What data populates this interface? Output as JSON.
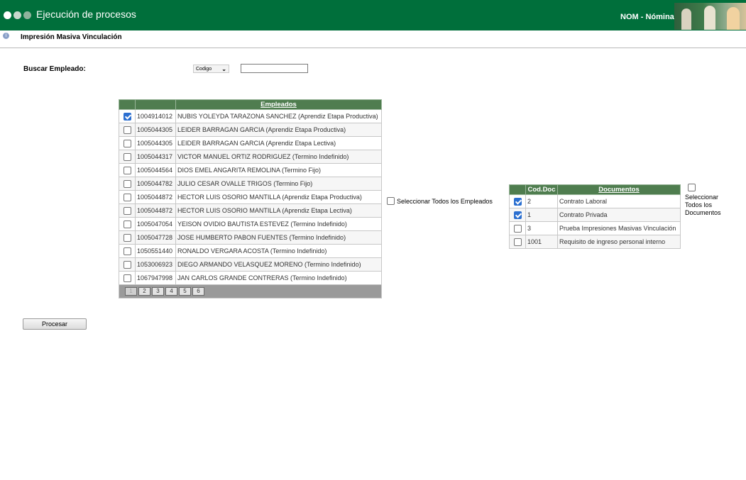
{
  "header": {
    "app_title": "Ejecución de procesos",
    "module": "NOM - Nómina",
    "color": "#006f3b"
  },
  "subheader": {
    "icon": "info-icon",
    "title": "Impresión Masiva  Vinculación"
  },
  "search": {
    "label": "Buscar Empleado:",
    "select_value": "Codigo",
    "input_value": ""
  },
  "employees": {
    "header": "Empleados",
    "rows": [
      {
        "checked": true,
        "code": "1004914012",
        "name": "NUBIS YOLEYDA TARAZONA SANCHEZ (Aprendiz Etapa Productiva)"
      },
      {
        "checked": false,
        "code": "1005044305",
        "name": "LEIDER BARRAGAN GARCIA (Aprendiz Etapa Productiva)"
      },
      {
        "checked": false,
        "code": "1005044305",
        "name": "LEIDER BARRAGAN GARCIA (Aprendiz Etapa Lectiva)"
      },
      {
        "checked": false,
        "code": "1005044317",
        "name": "VICTOR MANUEL ORTIZ RODRIGUEZ (Termino Indefinido)"
      },
      {
        "checked": false,
        "code": "1005044564",
        "name": "DIOS EMEL ANGARITA REMOLINA (Termino Fijo)"
      },
      {
        "checked": false,
        "code": "1005044782",
        "name": "JULIO CESAR OVALLE TRIGOS (Termino Fijo)"
      },
      {
        "checked": false,
        "code": "1005044872",
        "name": "HECTOR LUIS OSORIO MANTILLA (Aprendiz Etapa Productiva)"
      },
      {
        "checked": false,
        "code": "1005044872",
        "name": "HECTOR LUIS OSORIO MANTILLA (Aprendiz Etapa Lectiva)"
      },
      {
        "checked": false,
        "code": "1005047054",
        "name": "YEISON OVIDIO BAUTISTA ESTEVEZ (Termino Indefinido)"
      },
      {
        "checked": false,
        "code": "1005047728",
        "name": "JOSE HUMBERTO PABON FUENTES (Termino Indefinido)"
      },
      {
        "checked": false,
        "code": "1050551440",
        "name": "RONALDO VERGARA ACOSTA (Termino Indefinido)"
      },
      {
        "checked": false,
        "code": "1053006923",
        "name": "DIEGO ARMANDO VELASQUEZ MORENO (Termino Indefinido)"
      },
      {
        "checked": false,
        "code": "1067947998",
        "name": "JAN CARLOS GRANDE CONTRERAS (Termino Indefinido)"
      }
    ],
    "pages": [
      "1",
      "2",
      "3",
      "4",
      "5",
      "6"
    ],
    "current_page": "1",
    "select_all_label": "Seleccionar Todos los Empleados"
  },
  "documents": {
    "header_code": "Cod.Doc",
    "header_name": "Documentos",
    "rows": [
      {
        "checked": true,
        "code": "2",
        "name": "Contrato Laboral"
      },
      {
        "checked": true,
        "code": "1",
        "name": "Contrato Privada"
      },
      {
        "checked": false,
        "code": "3",
        "name": "Prueba Impresiones Masivas Vinculación"
      },
      {
        "checked": false,
        "code": "1001",
        "name": "Requisito de ingreso personal interno"
      }
    ],
    "select_all_label": "Seleccionar Todos los Documentos"
  },
  "actions": {
    "process_label": "Procesar"
  }
}
